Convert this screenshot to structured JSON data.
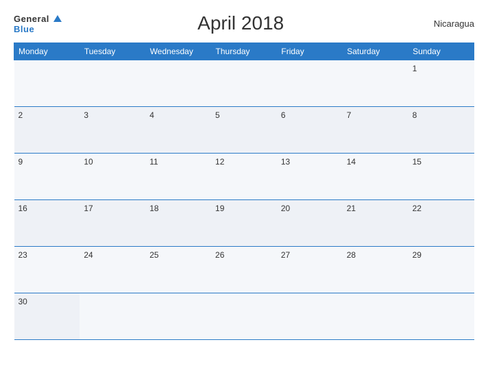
{
  "logo": {
    "general": "General",
    "blue": "Blue"
  },
  "title": "April 2018",
  "country": "Nicaragua",
  "days_header": [
    "Monday",
    "Tuesday",
    "Wednesday",
    "Thursday",
    "Friday",
    "Saturday",
    "Sunday"
  ],
  "weeks": [
    [
      "",
      "",
      "",
      "",
      "",
      "",
      "1"
    ],
    [
      "2",
      "3",
      "4",
      "5",
      "6",
      "7",
      "8"
    ],
    [
      "9",
      "10",
      "11",
      "12",
      "13",
      "14",
      "15"
    ],
    [
      "16",
      "17",
      "18",
      "19",
      "20",
      "21",
      "22"
    ],
    [
      "23",
      "24",
      "25",
      "26",
      "27",
      "28",
      "29"
    ],
    [
      "30",
      "",
      "",
      "",
      "",
      "",
      ""
    ]
  ]
}
